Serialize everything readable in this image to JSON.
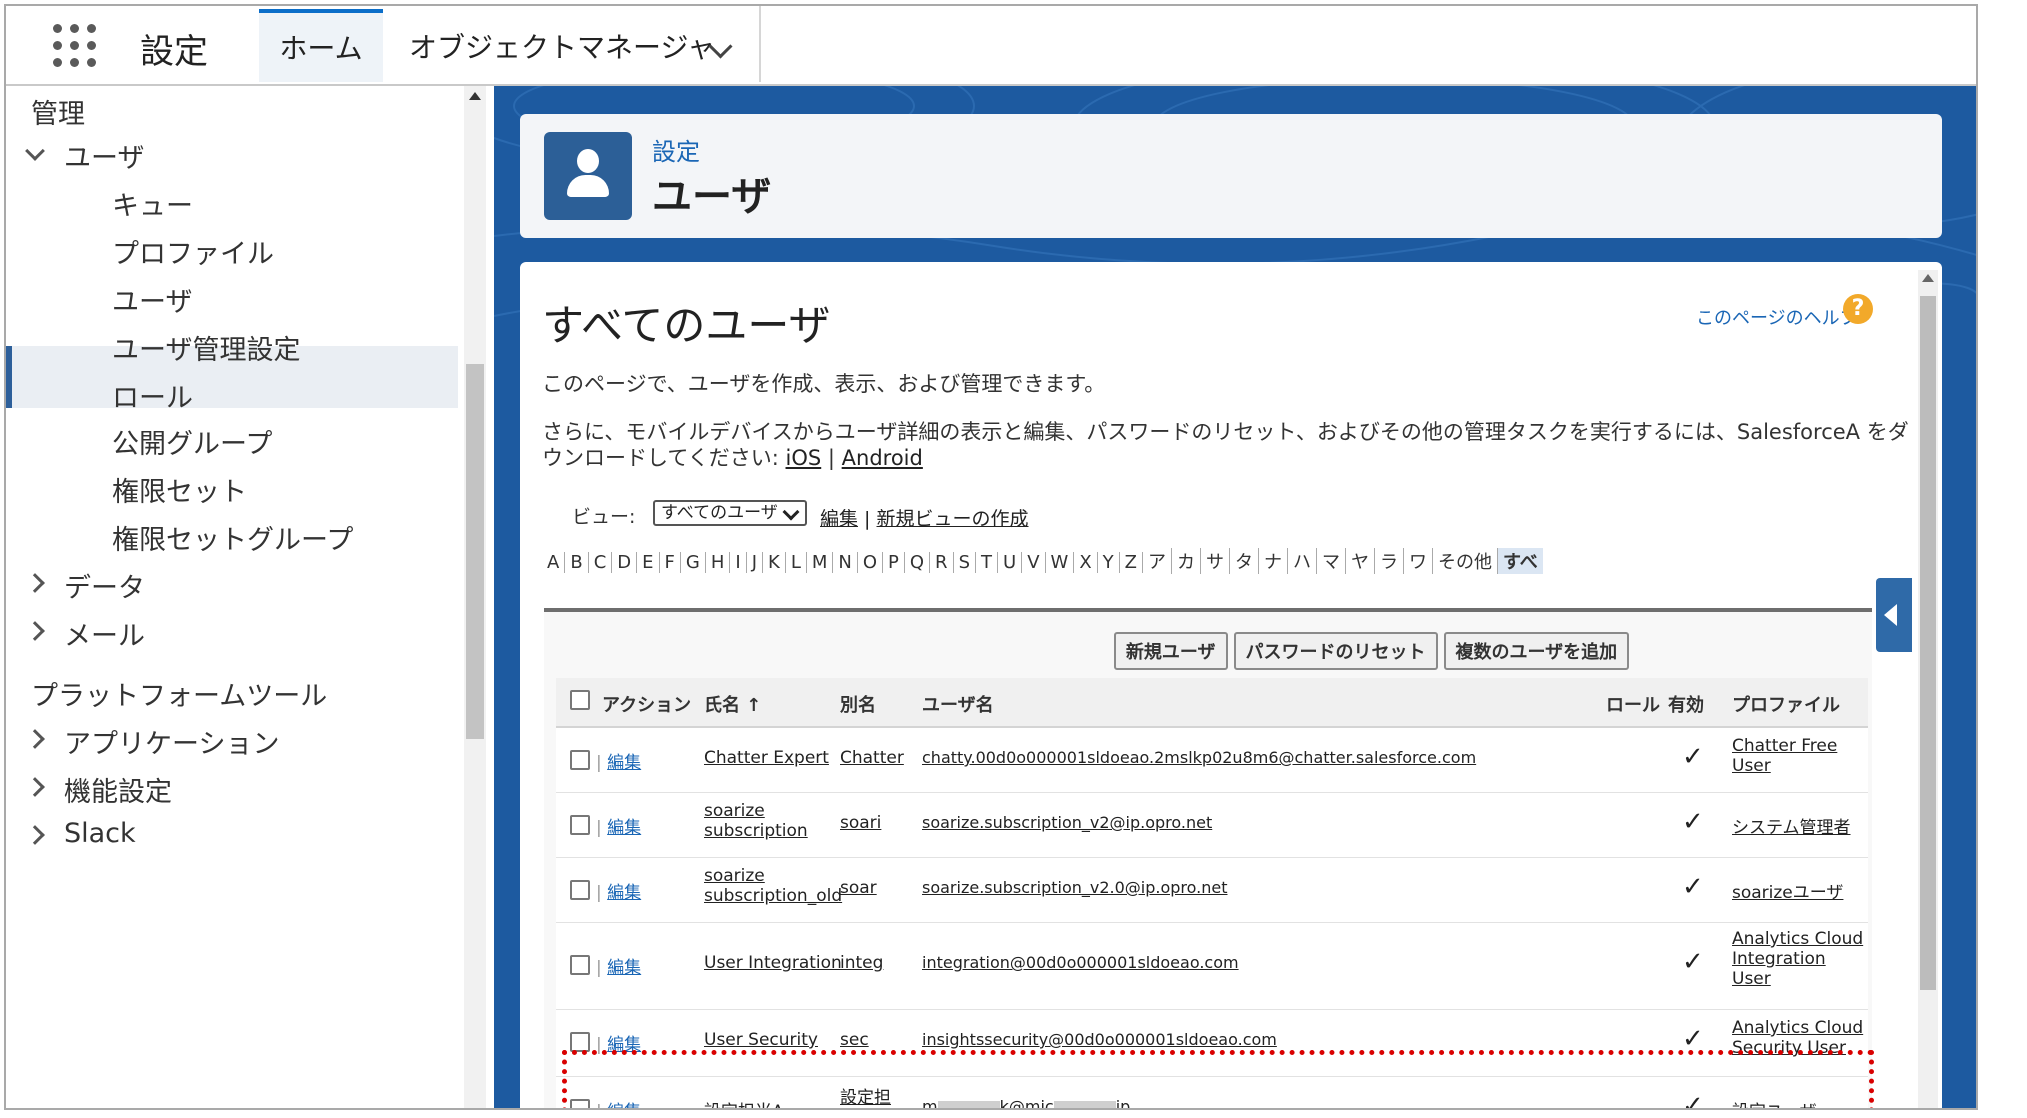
{
  "topbar": {
    "app_title": "設定",
    "tabs": [
      {
        "label": "ホーム"
      },
      {
        "label": "オブジェクトマネージャ"
      }
    ]
  },
  "sidebar": {
    "section_admin": "管理",
    "group_user": "ユーザ",
    "user_items": [
      "キュー",
      "プロファイル",
      "ユーザ",
      "ユーザ管理設定",
      "ロール",
      "公開グループ",
      "権限セット",
      "権限セットグループ"
    ],
    "selected_item": "ユーザ",
    "group_data": "データ",
    "group_mail": "メール",
    "section_platform": "プラットフォームツール",
    "group_apps": "アプリケーション",
    "group_features": "機能設定",
    "group_slack": "Slack"
  },
  "header": {
    "breadcrumb": "設定",
    "title": "ユーザ"
  },
  "content": {
    "title": "すべてのユーザ",
    "help_link": "このページのヘルプ",
    "description1": "このページで、ユーザを作成、表示、および管理できます。",
    "description2": "さらに、モバイルデバイスからユーザ詳細の表示と編集、パスワードのリセット、およびその他の管理タスクを実行するには、SalesforceA をダウンロードしてください:",
    "link_ios": "iOS",
    "link_android": "Android",
    "view_label": "ビュー:",
    "view_selected": "すべてのユーザ",
    "view_edit": "編集",
    "view_new": "新規ビューの作成",
    "alphabet": [
      "A",
      "B",
      "C",
      "D",
      "E",
      "F",
      "G",
      "H",
      "I",
      "J",
      "K",
      "L",
      "M",
      "N",
      "O",
      "P",
      "Q",
      "R",
      "S",
      "T",
      "U",
      "V",
      "W",
      "X",
      "Y",
      "Z",
      "ア",
      "カ",
      "サ",
      "タ",
      "ナ",
      "ハ",
      "マ",
      "ヤ",
      "ラ",
      "ワ",
      "その他",
      "すべ"
    ],
    "buttons": {
      "new_user": "新規ユーザ",
      "reset_password": "パスワードのリセット",
      "add_multiple": "複数のユーザを追加"
    },
    "columns": {
      "action": "アクション",
      "name": "氏名",
      "sort_arrow": "↑",
      "alias": "別名",
      "username": "ユーザ名",
      "role": "ロール",
      "active": "有効",
      "profile": "プロファイル"
    },
    "edit_label": "編集",
    "active_mark": "✓",
    "rows": [
      {
        "name": "Chatter Expert",
        "alias": "Chatter",
        "username": "chatty.00d0o000001sldoeao.2mslkp02u8m6@chatter.salesforce.com",
        "profile": "Chatter Free User"
      },
      {
        "name": "soarize subscription",
        "alias": "soari",
        "username": "soarize.subscription_v2@ip.opro.net",
        "profile": "システム管理者"
      },
      {
        "name": "soarize subscription_old",
        "alias": "soar",
        "username": "soarize.subscription_v2.0@ip.opro.net",
        "profile": "soarizeユーザ"
      },
      {
        "name": "User Integration",
        "alias": "integ",
        "username": "integration@00d0o000001sldoeao.com",
        "profile": "Analytics Cloud Integration User"
      },
      {
        "name": "User Security",
        "alias": "sec",
        "username": "insightssecurity@00d0o000001sldoeao.com",
        "profile": "Analytics Cloud Security User"
      },
      {
        "name": "設定担当A",
        "alias": "設定担当",
        "username_prefix": "m",
        "username_mid": "k@mic",
        "username_suffix": "jp",
        "profile": "設定ユーザ"
      }
    ]
  }
}
